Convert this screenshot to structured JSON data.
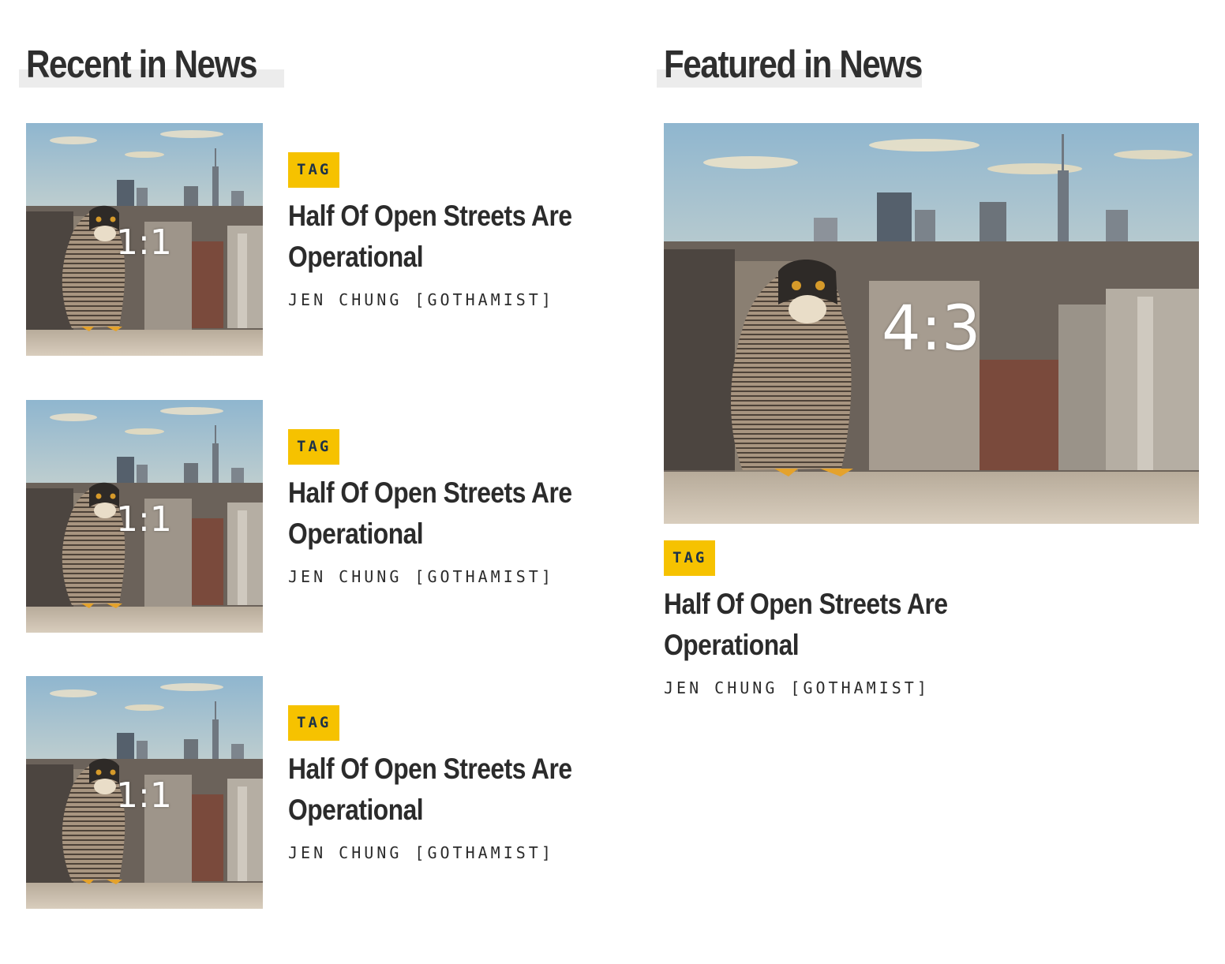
{
  "recent": {
    "heading": "Recent in News",
    "items": [
      {
        "image_label": "1:1",
        "tag": "TAG",
        "headline": "Half Of Open Streets Are Operational",
        "byline": "JEN CHUNG [GOTHAMIST]"
      },
      {
        "image_label": "1:1",
        "tag": "TAG",
        "headline": "Half Of Open Streets Are Operational",
        "byline": "JEN CHUNG [GOTHAMIST]"
      },
      {
        "image_label": "1:1",
        "tag": "TAG",
        "headline": "Half Of Open Streets Are Operational",
        "byline": "JEN CHUNG [GOTHAMIST]"
      }
    ]
  },
  "featured": {
    "heading": "Featured in News",
    "image_label": "4:3",
    "tag": "TAG",
    "headline": "Half Of Open Streets Are Operational",
    "byline": "JEN CHUNG [GOTHAMIST]"
  },
  "colors": {
    "tag_background": "#f6c200",
    "tag_text": "#1e3348",
    "text": "#2b2b2b",
    "heading_underline": "#ececec"
  },
  "icons": {
    "article_image": "falcon-over-city-skyline-photo"
  }
}
